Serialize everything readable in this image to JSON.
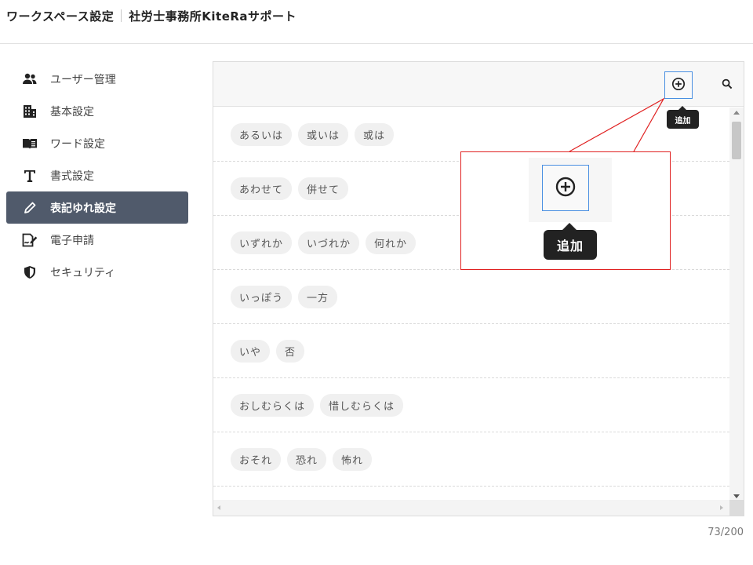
{
  "header": {
    "section": "ワークスペース設定",
    "workspace": "社労士事務所KiteRaサポート"
  },
  "sidebar": {
    "items": [
      {
        "label": "ユーザー管理",
        "icon": "users-icon",
        "active": false
      },
      {
        "label": "基本設定",
        "icon": "building-icon",
        "active": false
      },
      {
        "label": "ワード設定",
        "icon": "book-icon",
        "active": false
      },
      {
        "label": "書式設定",
        "icon": "text-format-icon",
        "active": false
      },
      {
        "label": "表記ゆれ設定",
        "icon": "pencil-icon",
        "active": true
      },
      {
        "label": "電子申請",
        "icon": "document-sign-icon",
        "active": false
      },
      {
        "label": "セキュリティ",
        "icon": "shield-icon",
        "active": false
      }
    ]
  },
  "toolbar": {
    "add_icon": "plus-circle-icon",
    "search_icon": "search-icon",
    "add_tooltip": "追加"
  },
  "rows": [
    [
      "あるいは",
      "或いは",
      "或は"
    ],
    [
      "あわせて",
      "併せて"
    ],
    [
      "いずれか",
      "いづれか",
      "何れか"
    ],
    [
      "いっぽう",
      "一方"
    ],
    [
      "いや",
      "否"
    ],
    [
      "おしむらくは",
      "惜しむらくは"
    ],
    [
      "おそれ",
      "恐れ",
      "怖れ"
    ]
  ],
  "callout": {
    "tooltip": "追加"
  },
  "counter": "73/200",
  "colors": {
    "active_nav": "#505a6b",
    "focus_border": "#4a90e2",
    "callout_border": "#e02020",
    "tooltip_bg": "#222222"
  }
}
